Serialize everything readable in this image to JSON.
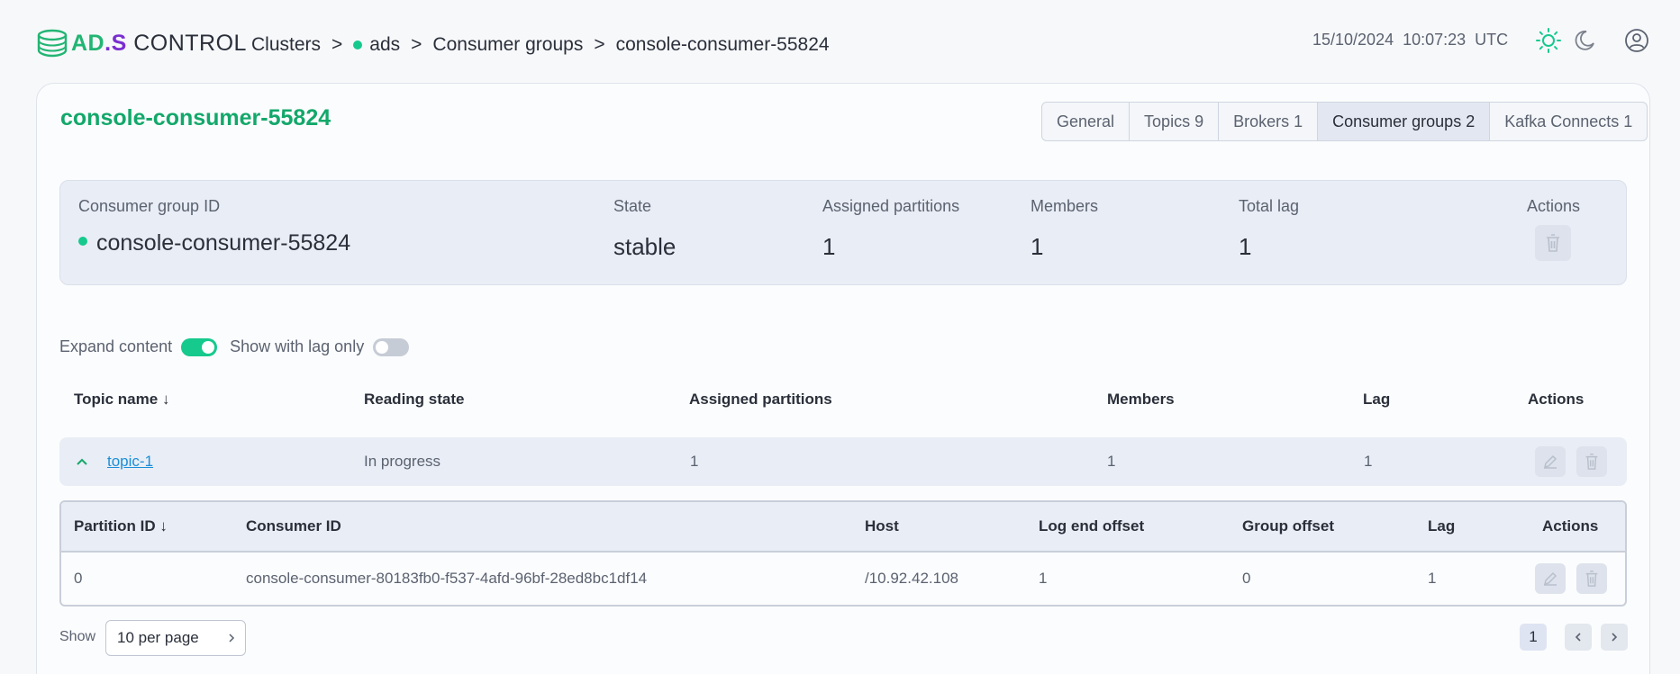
{
  "header": {
    "logo": {
      "ad": "AD",
      "dot": ".",
      "s": "S",
      "control": " CONTROL"
    },
    "breadcrumb": {
      "clusters": "Clusters",
      "sep": ">",
      "cluster": "ads",
      "consumer_groups": "Consumer groups",
      "current": "console-consumer-55824"
    },
    "date": "15/10/2024",
    "time": "10:07:23",
    "tz": "UTC",
    "icons": [
      "light-theme-icon",
      "dark-theme-icon",
      "user-profile-icon"
    ]
  },
  "page": {
    "title": "console-consumer-55824",
    "tabs": [
      {
        "label": "General"
      },
      {
        "label": "Topics 9"
      },
      {
        "label": "Brokers 1"
      },
      {
        "label": "Consumer groups 2",
        "active": true
      },
      {
        "label": "Kafka Connects 1"
      }
    ]
  },
  "summary": {
    "group_id_label": "Consumer group ID",
    "group_id": "console-consumer-55824",
    "state_label": "State",
    "state": "stable",
    "assigned_label": "Assigned partitions",
    "assigned": "1",
    "members_label": "Members",
    "members": "1",
    "lag_label": "Total lag",
    "lag": "1",
    "actions_label": "Actions"
  },
  "filters": {
    "expand_label": "Expand content",
    "expand_on": true,
    "lag_only_label": "Show with lag only",
    "lag_only_on": false
  },
  "topic_table": {
    "headers": {
      "topic": "Topic name",
      "sort_icon": "↓",
      "reading": "Reading state",
      "assigned": "Assigned partitions",
      "members": "Members",
      "lag": "Lag",
      "actions": "Actions"
    },
    "rows": [
      {
        "topic": "topic-1",
        "reading": "In progress",
        "assigned": "1",
        "members": "1",
        "lag": "1"
      }
    ]
  },
  "partition_table": {
    "headers": {
      "partition": "Partition ID",
      "sort_icon": "↓",
      "consumer": "Consumer ID",
      "host": "Host",
      "log_end": "Log end offset",
      "group_offset": "Group offset",
      "lag": "Lag",
      "actions": "Actions"
    },
    "rows": [
      {
        "partition": "0",
        "consumer": "console-consumer-80183fb0-f537-4afd-96bf-28ed8bc1df14",
        "host": "/10.92.42.108",
        "log_end": "1",
        "group_offset": "0",
        "lag": "1"
      }
    ]
  },
  "pagination": {
    "show_label": "Show",
    "per_page": "10 per page",
    "current_page": "1"
  },
  "colors": {
    "accent": "#16c98d",
    "title_green": "#13a86b",
    "link_blue": "#1a8fd8",
    "logo_purple": "#7a2fd0"
  }
}
